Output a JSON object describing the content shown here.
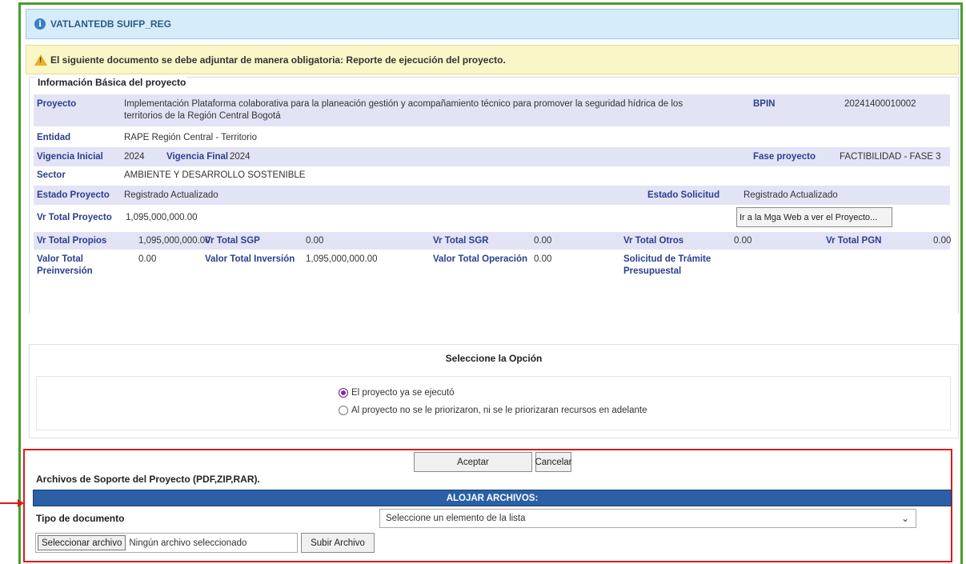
{
  "header": {
    "title": "VATLANTEDB SUIFP_REG",
    "info_icon": "info-icon"
  },
  "warning": {
    "text": "El siguiente documento se debe adjuntar de manera obligatoria: Reporte de ejecución del proyecto.",
    "icon": "warning-icon"
  },
  "basic_info": {
    "legend": "Información Básica del proyecto",
    "proyecto_label": "Proyecto",
    "proyecto_value_1": "Implementación Plataforma colaborativa para la planeación gestión y acompañamiento técnico para promover la seguridad hídrica de los",
    "proyecto_value_2": "territorios de la Región Central Bogotá",
    "bpin_label": "BPIN",
    "bpin_value": "20241400010002",
    "entidad_label": "Entidad",
    "entidad_value": "RAPE Región Central - Territorio",
    "vigencia_inicial_label": "Vigencia Inicial",
    "vigencia_inicial_value": "2024",
    "vigencia_final_label": "Vigencia Final",
    "vigencia_final_value": "2024",
    "fase_label": "Fase proyecto",
    "fase_value": "FACTIBILIDAD - FASE 3",
    "sector_label": "Sector",
    "sector_value": "AMBIENTE Y DESARROLLO SOSTENIBLE",
    "estado_proyecto_label": "Estado Proyecto",
    "estado_proyecto_value": "Registrado Actualizado",
    "estado_solicitud_label": "Estado Solicitud",
    "estado_solicitud_value": "Registrado Actualizado",
    "vr_total_proyecto_label": "Vr Total Proyecto",
    "vr_total_proyecto_value": "1,095,000,000.00",
    "mga_button": "Ir a la Mga Web a ver el Proyecto...",
    "vr_total_propios_label": "Vr Total Propios",
    "vr_total_propios_value": "1,095,000,000.00",
    "vr_total_sgp_label": "Vr Total SGP",
    "vr_total_sgp_value": "0.00",
    "vr_total_sgr_label": "Vr Total SGR",
    "vr_total_sgr_value": "0.00",
    "vr_total_otros_label": "Vr Total Otros",
    "vr_total_otros_value": "0.00",
    "vr_total_pgn_label": "Vr Total PGN",
    "vr_total_pgn_value": "0.00",
    "valor_preinv_label_1": "Valor Total",
    "valor_preinv_label_2": "Preinversión",
    "valor_preinv_value": "0.00",
    "valor_inversion_label": "Valor Total Inversión",
    "valor_inversion_value": "1,095,000,000.00",
    "valor_operacion_label": "Valor Total Operación",
    "valor_operacion_value": "0.00",
    "solicitud_label_1": "Solicitud de Trámite",
    "solicitud_label_2": "Presupuestal"
  },
  "options": {
    "title": "Seleccione la Opción",
    "option_1": "El proyecto ya se ejecutó",
    "option_2": "Al proyecto no se le priorizaron, ni se le priorizaran recursos en adelante",
    "selected": "option_1"
  },
  "actions": {
    "accept": "Aceptar",
    "cancel": "Cancelar"
  },
  "files": {
    "label": "Archivos de Soporte del Proyecto (PDF,ZIP,RAR).",
    "section_header": "ALOJAR ARCHIVOS:",
    "tipo_label": "Tipo de documento",
    "tipo_selected": "Seleccione un elemento de la lista",
    "select_file_button": "Seleccionar archivo",
    "file_status": "Ningún archivo seleccionado",
    "upload_button": "Subir Archivo"
  },
  "colors": {
    "frame_border": "#4a9c2e",
    "highlight_border": "#e0191c",
    "header_bar": "#2b5fa6",
    "label_color": "#2a3f8f",
    "shaded_row": "#e3e3f6"
  }
}
